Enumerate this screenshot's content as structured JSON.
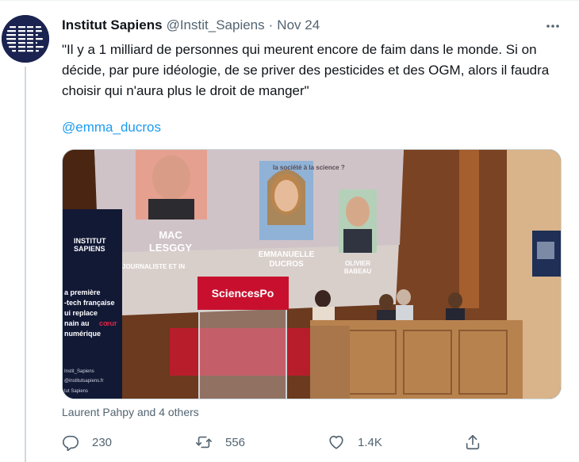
{
  "tweet": {
    "author_name": "Institut Sapiens",
    "handle": "@Instit_Sapiens",
    "separator": "·",
    "date": "Nov 24",
    "text": "\"Il y a 1 milliard de personnes qui meurent encore de faim dans le monde. Si on décide, par pure idéologie, de se priver des pesticides et des OGM, alors il faudra choisir qui n'aura plus le droit de manger\"",
    "mention": "@emma_ducros",
    "tagged_people": "Laurent Pahpy and 4 others"
  },
  "photo": {
    "speaker1_name_line1": "MAC",
    "speaker1_name_line2": "LESGGY",
    "speaker1_role": "JOURNALISTE ET IN",
    "speaker2_name_line1": "EMMANUELLE",
    "speaker2_name_line2": "DUCROS",
    "speaker3_name_line1": "OLIVIER",
    "speaker3_name_line2": "BABEAU",
    "slide_heading": "la société à la science ?",
    "podium_label": "SciencesPo",
    "banner_brand_line1": "INSTITUT",
    "banner_brand_line2": "SAPIENS",
    "banner_text": [
      "a première",
      "-tech française",
      "ui replace",
      "nain au",
      "numérique"
    ],
    "banner_highlight": "cœur",
    "banner_handle": "Instit_Sapiens",
    "banner_site": "@institutsapiens.fr",
    "banner_footer": "tut Sapiens"
  },
  "actions": {
    "reply_count": "230",
    "retweet_count": "556",
    "like_count": "1.4K"
  },
  "icons": {
    "more": "more-horizontal-icon",
    "reply": "reply-icon",
    "retweet": "retweet-icon",
    "like": "heart-icon",
    "share": "share-icon"
  },
  "colors": {
    "link": "#1d9bf0",
    "secondary_text": "#536471",
    "avatar_bg": "#1b2350",
    "podium_red": "#c8102e"
  }
}
